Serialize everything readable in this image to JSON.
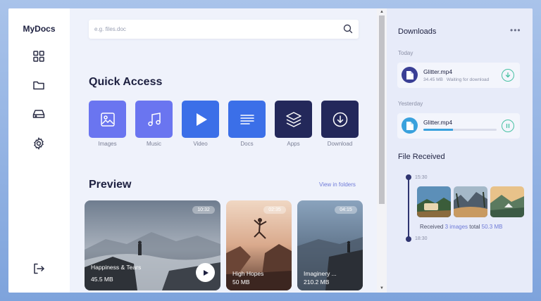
{
  "app": {
    "title": "MyDocs"
  },
  "sidebar": {
    "items": [
      {
        "icon": "grid-icon"
      },
      {
        "icon": "folder-icon"
      },
      {
        "icon": "drive-icon"
      },
      {
        "icon": "gear-icon"
      },
      {
        "icon": "logout-icon"
      }
    ]
  },
  "search": {
    "placeholder": "e.g. files.doc",
    "value": ""
  },
  "quick_access": {
    "title": "Quick Access",
    "items": [
      {
        "label": "Images",
        "color": "#6a75f0",
        "icon": "image-icon"
      },
      {
        "label": "Music",
        "color": "#6a75f0",
        "icon": "music-icon"
      },
      {
        "label": "Video",
        "color": "#3b6fe8",
        "icon": "play-icon"
      },
      {
        "label": "Docs",
        "color": "#3b6fe8",
        "icon": "document-icon"
      },
      {
        "label": "Apps",
        "color": "#23285a",
        "icon": "layers-icon"
      },
      {
        "label": "Download",
        "color": "#23285a",
        "icon": "download-icon"
      }
    ]
  },
  "preview": {
    "title": "Preview",
    "link": "View in folders",
    "cards": [
      {
        "title": "Happiness & Tears",
        "size": "45.5 MB",
        "duration": "10:32"
      },
      {
        "title": "High Hopes",
        "size": "50 MB",
        "duration": "02:35"
      },
      {
        "title": "Imaginery ...",
        "size": "210.2 MB",
        "duration": "04:15"
      }
    ]
  },
  "downloads": {
    "title": "Downloads",
    "more": "•••",
    "today_label": "Today",
    "today": {
      "name": "Glitter.mp4",
      "size": "34.45 MB",
      "status": "Waiting for download"
    },
    "yesterday_label": "Yesterday",
    "yesterday": {
      "name": "Glitter.mp4",
      "progress": 0.4
    }
  },
  "file_received": {
    "title": "File Received",
    "time_start": "15:30",
    "time_end": "18:30",
    "prefix": "Received",
    "count": "3 images",
    "mid": "total",
    "total": "50.3 MB"
  },
  "colors": {
    "accent": "#6a75f0",
    "dark": "#23285a",
    "teal": "#47c1a3",
    "progress": "#3aa1dd"
  }
}
